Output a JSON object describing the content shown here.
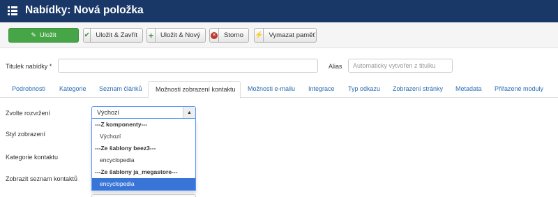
{
  "header": {
    "title": "Nabídky: Nová položka"
  },
  "toolbar": {
    "save": "Uložit",
    "save_close": "Uložit & Zavřít",
    "save_new": "Uložit & Nový",
    "cancel": "Storno",
    "clear_cache": "Vymazat paměť"
  },
  "form": {
    "title_label": "Titulek nabídky *",
    "title_value": "",
    "alias_label": "Alias",
    "alias_placeholder": "Automaticky vytvořen z titulku"
  },
  "tabs": [
    "Podrobnosti",
    "Kategorie",
    "Seznam článků",
    "Možnosti zobrazení kontaktu",
    "Možnosti e-mailu",
    "Integrace",
    "Typ odkazu",
    "Zobrazení stránky",
    "Metadata",
    "Přiřazené moduly"
  ],
  "active_tab": "Možnosti zobrazení kontaktu",
  "fields": {
    "layout_label": "Zvolte rozvržení",
    "style_label": "Styl zobrazení",
    "category_label": "Kategorie kontaktu",
    "show_list_label": "Zobrazit seznam kontaktů"
  },
  "layout_select": {
    "selected": "Výchozí",
    "options": [
      {
        "text": "---Z komponenty---",
        "group": true
      },
      {
        "text": "Výchozí",
        "group": false
      },
      {
        "text": "---Ze šablony beez3---",
        "group": true
      },
      {
        "text": "encyclopedia",
        "group": false
      },
      {
        "text": "---Ze šablony ja_megastore---",
        "group": true
      },
      {
        "text": "encyclopedia",
        "group": false,
        "highlighted": true
      }
    ]
  },
  "colors": {
    "header_bg": "#1a3867",
    "save_button": "#46a546",
    "link": "#2a6cb3",
    "highlight": "#3875d7"
  }
}
